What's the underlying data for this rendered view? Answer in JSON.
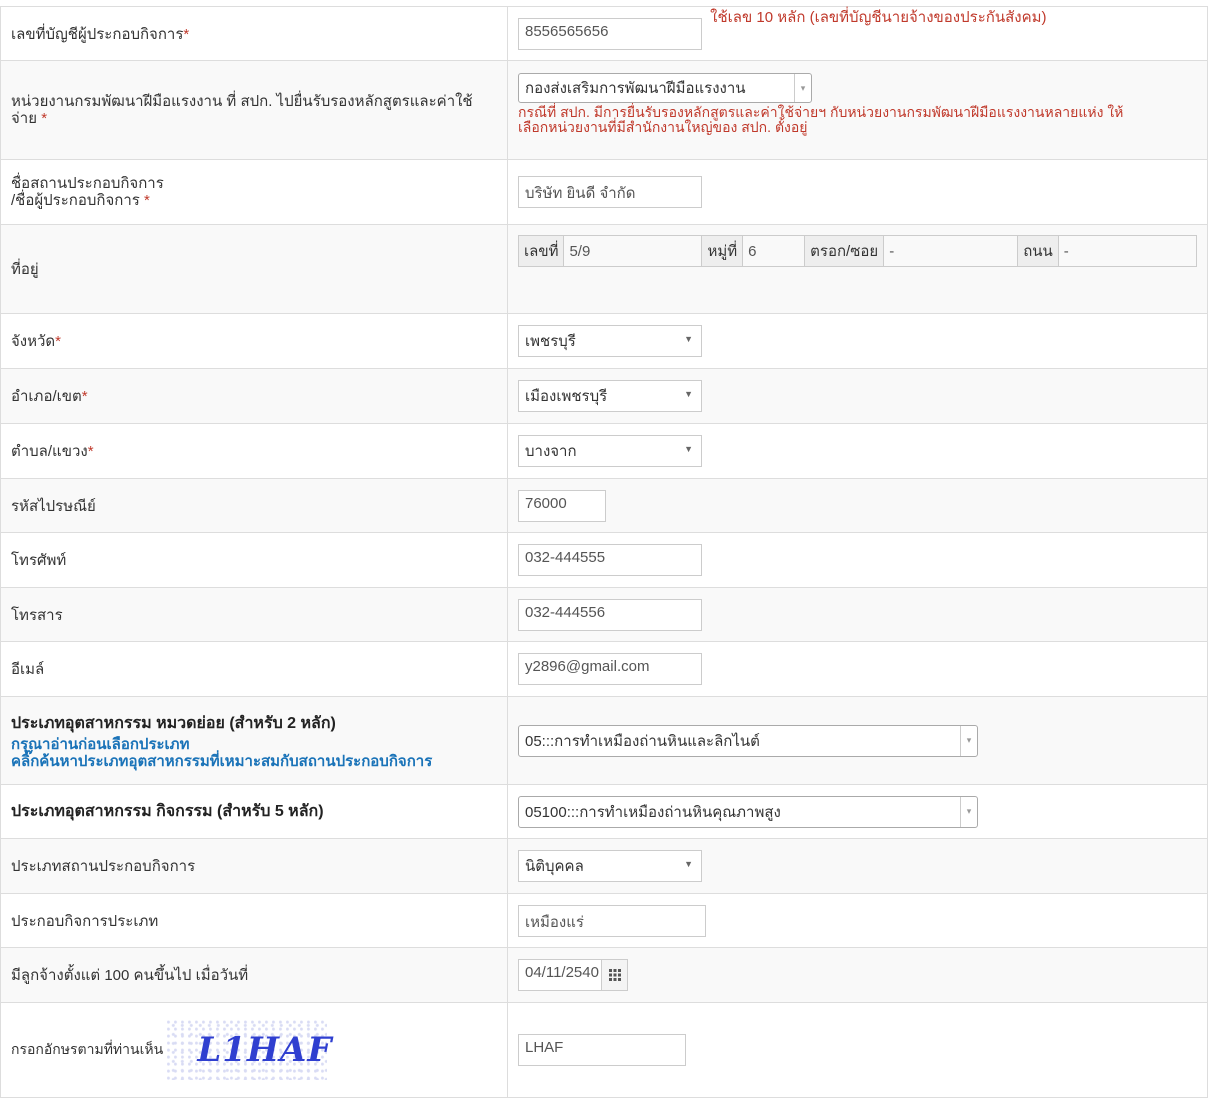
{
  "rows": {
    "account": {
      "label": "เลขที่บัญชีผู้ประกอบกิจการ",
      "req": "*",
      "value": "8556565656",
      "note": "ใช้เลข 10 หลัก (เลขที่บัญชีนายจ้างของประกันสังคม)"
    },
    "unit": {
      "label": "หน่วยงานกรมพัฒนาฝีมือแรงงาน ที่ สปก. ไปยื่นรับรองหลักสูตรและค่าใช้จ่าย",
      "req": "*",
      "selected": "กองส่งเสริมการพัฒนาฝีมือแรงงาน",
      "note_line1": "กรณีที่ สปก. มีการยื่นรับรองหลักสูตรและค่าใช้จ่ายฯ กับหน่วยงานกรมพัฒนาฝีมือแรงงานหลายแห่ง ให้",
      "note_line2": "เลือกหน่วยงานที่มีสำนักงานใหญ่ของ สปก. ตั้งอยู่"
    },
    "name": {
      "label_line1": "ชื่อสถานประกอบกิจการ",
      "label_line2": "/ชื่อผู้ประกอบกิจการ",
      "req": "*",
      "value": "บริษัท ยินดี จำกัด"
    },
    "address": {
      "label": "ที่อยู่",
      "no_label": "เลขที่",
      "no_value": "5/9",
      "moo_label": "หมู่ที่",
      "moo_value": "6",
      "soi_label": "ตรอก/ซอย",
      "soi_value": "-",
      "road_label": "ถนน",
      "road_value": "-"
    },
    "province": {
      "label": "จังหวัด",
      "req": "*",
      "selected": "เพชรบุรี"
    },
    "district": {
      "label": "อำเภอ/เขต",
      "req": "*",
      "selected": "เมืองเพชรบุรี"
    },
    "subdistrict": {
      "label": "ตำบล/แขวง",
      "req": "*",
      "selected": "บางจาก"
    },
    "postcode": {
      "label": "รหัสไปรษณีย์",
      "value": "76000"
    },
    "phone": {
      "label": "โทรศัพท์",
      "value": "032-444555"
    },
    "fax": {
      "label": "โทรสาร",
      "value": "032-444556"
    },
    "email": {
      "label": "อีเมล์",
      "value": "y2896@gmail.com"
    },
    "industry2": {
      "label": "ประเภทอุตสาหกรรม หมวดย่อย (สำหรับ 2 หลัก)",
      "link1": "กรุณาอ่านก่อนเลือกประเภท",
      "link2": "คลิ๊กค้นหาประเภทอุตสาหกรรมที่เหมาะสมกับสถานประกอบกิจการ",
      "selected": "05:::การทำเหมืองถ่านหินและลิกไนต์"
    },
    "industry5": {
      "label": "ประเภทอุตสาหกรรม กิจกรรม (สำหรับ 5 หลัก)",
      "selected": "05100:::การทำเหมืองถ่านหินคุณภาพสูง"
    },
    "biztype": {
      "label": "ประเภทสถานประกอบกิจการ",
      "selected": "นิติบุคคล"
    },
    "bizkind": {
      "label": "ประกอบกิจการประเภท",
      "value": "เหมืองแร่"
    },
    "since": {
      "label": "มีลูกจ้างตั้งแต่ 100 คนขึ้นไป เมื่อวันที่",
      "value": "04/11/2540"
    },
    "captcha": {
      "label": "กรอกอักษรตามที่ท่านเห็น",
      "image_text": "L1HAF",
      "value": "LHAF"
    }
  },
  "icons": {
    "caret": "caret-down-icon",
    "calendar": "calendar-icon"
  }
}
